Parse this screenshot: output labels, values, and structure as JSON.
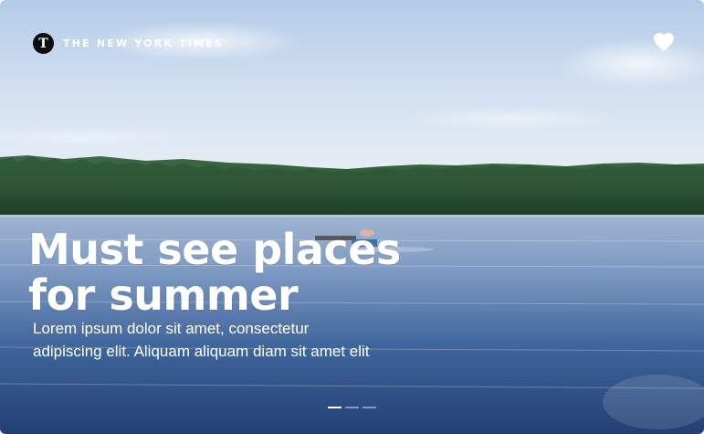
{
  "brand": {
    "logo_letter": "T",
    "name": "THE NEW YORK TIMES"
  },
  "actions": {
    "favorite_icon": "heart-icon"
  },
  "article": {
    "headline": "Must see places\nfor summer",
    "summary": "Lorem ipsum dolor sit amet, consectetur\nadipiscing elit. Aliquam aliquam diam sit amet elit"
  },
  "carousel": {
    "total_slides": 3,
    "active_slide": 1
  },
  "colors": {
    "sky_top": "#b9d0ea",
    "forest": "#2f5a35",
    "lake": "#3a5f96",
    "text": "#ffffff"
  }
}
